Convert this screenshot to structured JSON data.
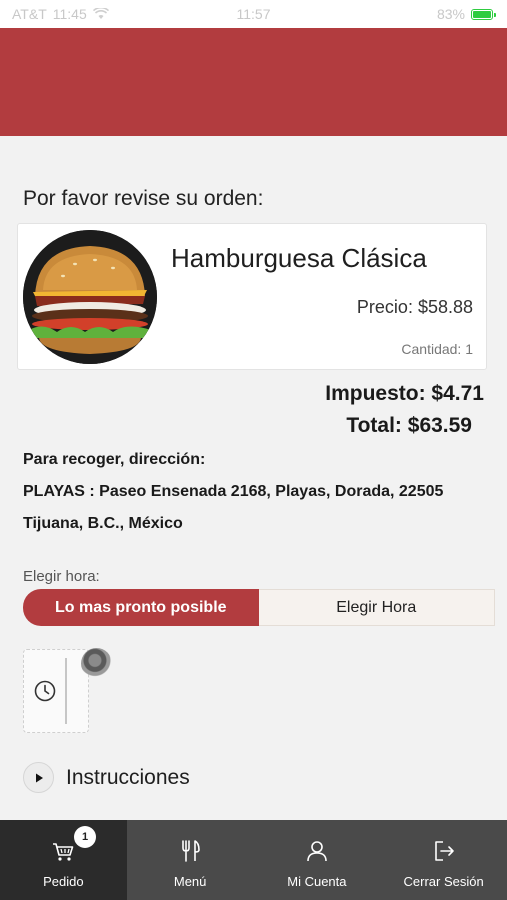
{
  "status_bar": {
    "carrier": "AT&T",
    "time_left": "11:45",
    "time_center": "11:57",
    "battery_text": "83%"
  },
  "colors": {
    "brand_red": "#b23c3f",
    "nav_bg": "#4a4a4a",
    "nav_active_bg": "#2b2b2b"
  },
  "review_title": "Por favor revise su orden:",
  "item": {
    "name": "Hamburguesa Clásica",
    "price": "Precio: $58.88",
    "quantity": "Cantidad: 1",
    "image_icon": "burger-photo"
  },
  "totals": {
    "tax": "Impuesto: $4.71",
    "total": "Total: $63.59"
  },
  "pickup": {
    "label": "Para recoger, dirección:",
    "address_line1": "PLAYAS : Paseo Ensenada 2168, Playas, Dorada, 22505",
    "address_line2": "Tijuana, B.C., México"
  },
  "time_selector": {
    "label": "Elegir hora:",
    "option_asap": "Lo mas pronto posible",
    "option_choose": "Elegir Hora",
    "selected": "Lo mas pronto posible"
  },
  "instructions": {
    "label": "Instrucciones"
  },
  "bottom_nav": {
    "items": [
      {
        "label": "Pedido",
        "icon": "cart-icon",
        "badge": "1",
        "active": true
      },
      {
        "label": "Menú",
        "icon": "fork-knife-icon",
        "active": false
      },
      {
        "label": "Mi Cuenta",
        "icon": "user-icon",
        "active": false
      },
      {
        "label": "Cerrar Sesión",
        "icon": "logout-icon",
        "active": false
      }
    ]
  }
}
